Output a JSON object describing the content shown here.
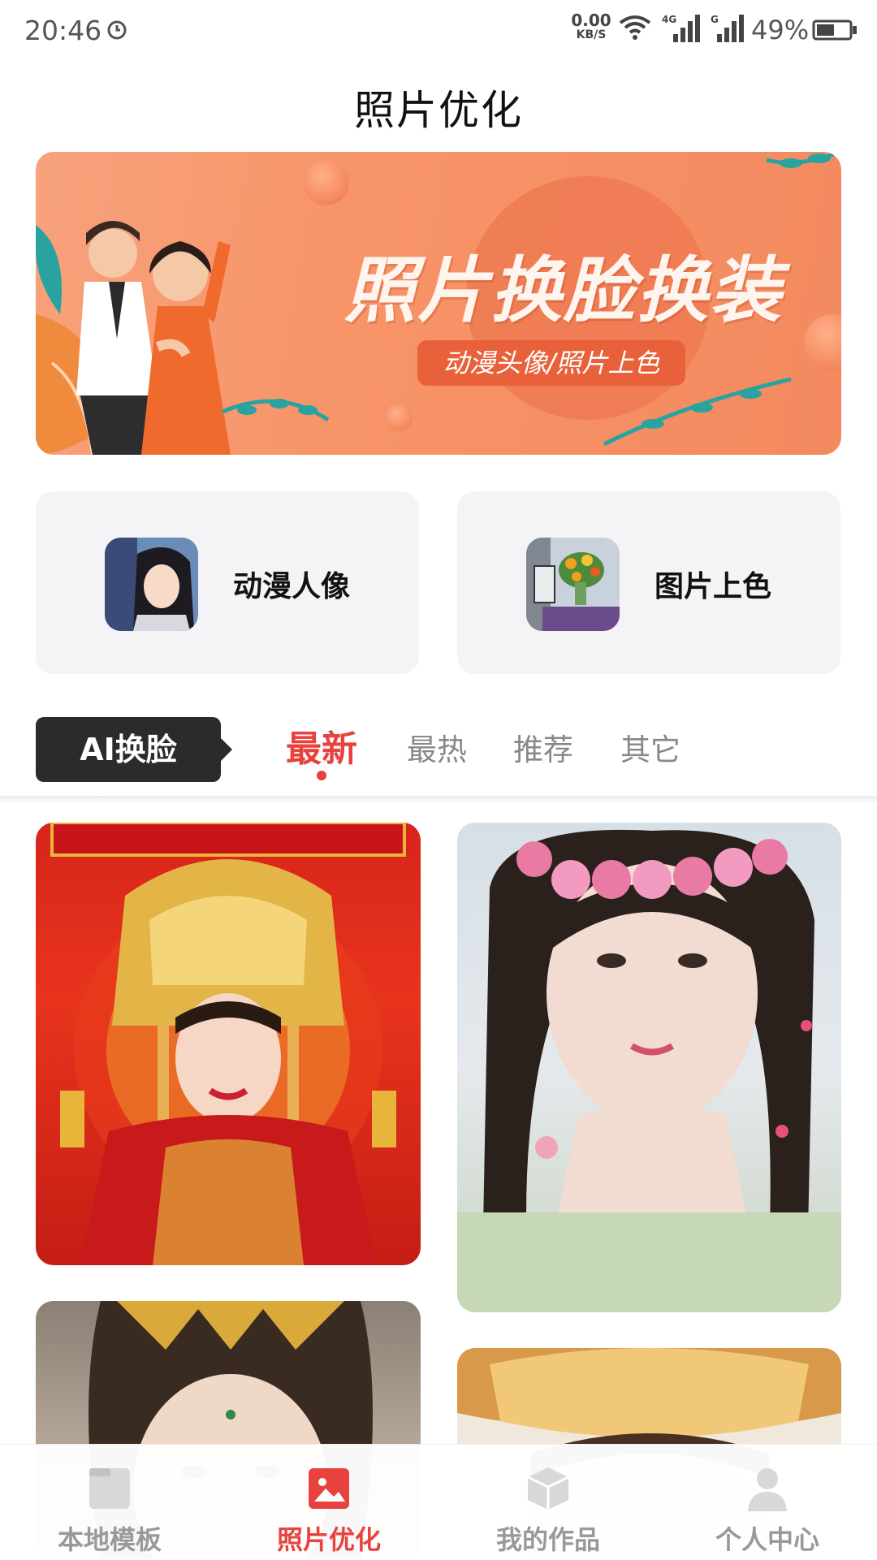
{
  "status_bar": {
    "time": "20:46",
    "net_speed_value": "0.00",
    "net_speed_unit": "KB/S",
    "battery": "49%",
    "icons": [
      "alarm-icon",
      "wifi-icon",
      "signal-4g-icon",
      "signal-g-icon",
      "battery-icon"
    ]
  },
  "header": {
    "title": "照片优化"
  },
  "banner": {
    "title": "照片换脸换装",
    "subtitle": "动漫头像/照片上色",
    "colors": {
      "background": "#f7a27c",
      "accent": "#e8613a"
    }
  },
  "features": [
    {
      "label": "动漫人像",
      "icon": "anime-portrait-thumb"
    },
    {
      "label": "图片上色",
      "icon": "photo-colorize-thumb"
    }
  ],
  "section": {
    "badge": "AI换脸",
    "tabs": [
      {
        "label": "最新",
        "active": true
      },
      {
        "label": "最热",
        "active": false
      },
      {
        "label": "推荐",
        "active": false
      },
      {
        "label": "其它",
        "active": false
      }
    ]
  },
  "bottom_nav": [
    {
      "label": "本地模板",
      "icon": "template-icon",
      "active": false
    },
    {
      "label": "照片优化",
      "icon": "image-icon",
      "active": true
    },
    {
      "label": "我的作品",
      "icon": "box-icon",
      "active": false
    },
    {
      "label": "个人中心",
      "icon": "user-icon",
      "active": false
    }
  ],
  "colors": {
    "accent": "#e8423e",
    "dark_badge": "#2b2b2b",
    "inactive": "#999999"
  }
}
